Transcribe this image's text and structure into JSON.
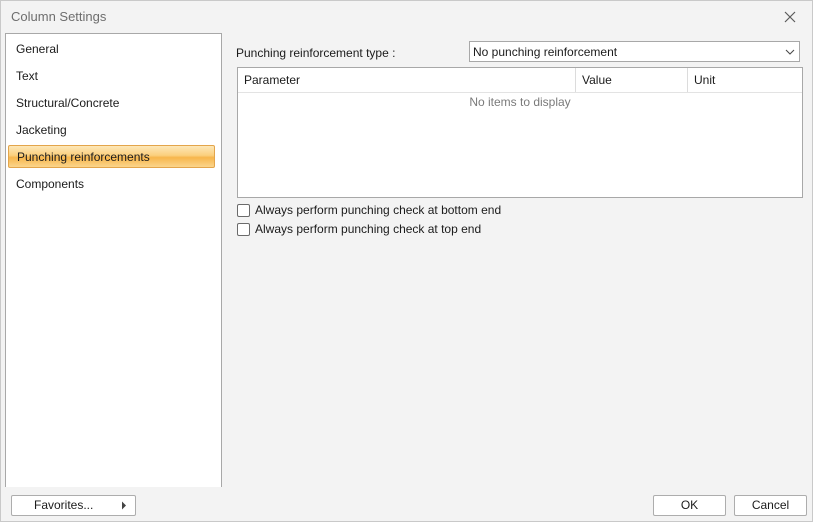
{
  "window": {
    "title": "Column Settings"
  },
  "nav": {
    "items": [
      {
        "label": "General"
      },
      {
        "label": "Text"
      },
      {
        "label": "Structural/Concrete"
      },
      {
        "label": "Jacketing"
      },
      {
        "label": "Punching reinforcements",
        "selected": true
      },
      {
        "label": "Components"
      }
    ]
  },
  "content": {
    "type_label": "Punching reinforcement type :",
    "type_value": "No punching reinforcement",
    "grid": {
      "columns": [
        "Parameter",
        "Value",
        "Unit"
      ],
      "empty_text": "No items to display"
    },
    "checks": [
      {
        "label": "Always perform punching check at bottom end",
        "checked": false
      },
      {
        "label": "Always perform punching check at top end",
        "checked": false
      }
    ]
  },
  "footer": {
    "favorites_label": "Favorites...",
    "ok_label": "OK",
    "cancel_label": "Cancel"
  },
  "colors": {
    "selection": "#f7b64c",
    "border": "#a8a8a8"
  },
  "icons": {
    "close": "close-icon",
    "dropdown": "chevron-down-icon",
    "submenu": "chevron-right-icon"
  }
}
